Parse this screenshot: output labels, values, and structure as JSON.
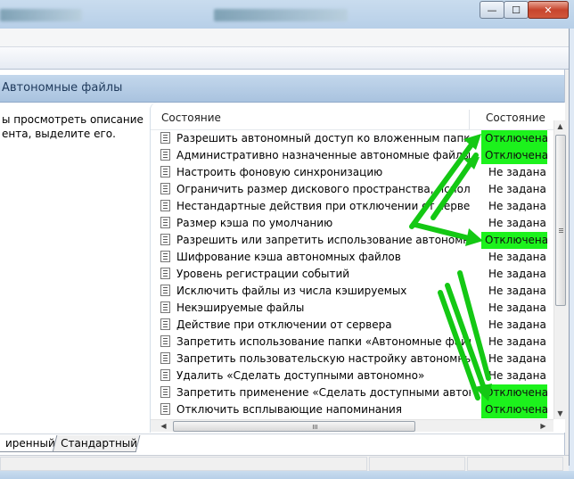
{
  "window": {
    "minimize_icon": "minimize-icon",
    "maximize_icon": "maximize-icon",
    "close_icon": "close-icon",
    "minimize_glyph": "—",
    "maximize_glyph": "☐",
    "close_glyph": "✕"
  },
  "header": {
    "title": "Автономные файлы"
  },
  "description": {
    "text": "ы просмотреть описание\nента, выделите его."
  },
  "list": {
    "column_name": "Состояние",
    "column_state": "Состояние",
    "rows": [
      {
        "name": "Разрешить автономный доступ ко вложенным папкам",
        "state": "Отключена",
        "highlight": true
      },
      {
        "name": "Административно назначенные автономные файлы",
        "state": "Отключена",
        "highlight": true
      },
      {
        "name": "Настроить фоновую синхронизацию",
        "state": "Не задана",
        "highlight": false
      },
      {
        "name": "Ограничить размер дискового пространства, использе",
        "state": "Не задана",
        "highlight": false
      },
      {
        "name": "Нестандартные действия при отключении от сервера",
        "state": "Не задана",
        "highlight": false
      },
      {
        "name": "Размер кэша по умолчанию",
        "state": "Не задана",
        "highlight": false
      },
      {
        "name": "Разрешить или запретить использование автономных фа...",
        "state": "Отключена",
        "highlight": true
      },
      {
        "name": "Шифрование кэша автономных файлов",
        "state": "Не задана",
        "highlight": false
      },
      {
        "name": "Уровень регистрации событий",
        "state": "Не задана",
        "highlight": false
      },
      {
        "name": "Исключить файлы из числа кэшируемых",
        "state": "Не задана",
        "highlight": false
      },
      {
        "name": "Некэшируемые файлы",
        "state": "Не задана",
        "highlight": false
      },
      {
        "name": "Действие при отключении от сервера",
        "state": "Не задана",
        "highlight": false
      },
      {
        "name": "Запретить использование папки «Автономные файлы»",
        "state": "Не задана",
        "highlight": false
      },
      {
        "name": "Запретить пользовательскую настройку автономных фа...",
        "state": "Не задана",
        "highlight": false
      },
      {
        "name": "Удалить «Сделать доступными автономно»",
        "state": "Не задана",
        "highlight": false
      },
      {
        "name": "Запретить применение «Сделать доступными автономно...",
        "state": "Отключена",
        "highlight": true
      },
      {
        "name": "Отключить всплывающие напоминания",
        "state": "Отключена",
        "highlight": true
      }
    ]
  },
  "scrollbars": {
    "up_glyph": "▲",
    "down_glyph": "▼",
    "left_glyph": "◀",
    "right_glyph": "▶"
  },
  "tabs": [
    {
      "label": "иренный"
    },
    {
      "label": "Стандартный"
    }
  ],
  "colors": {
    "highlight": "#1cf21c",
    "arrow": "#14c814",
    "header_band": "#b3cbe6"
  }
}
